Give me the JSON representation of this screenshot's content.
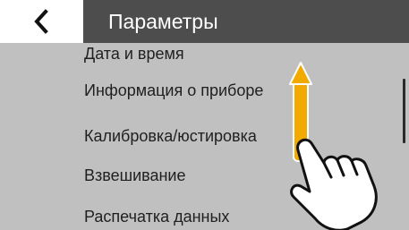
{
  "header": {
    "title": "Параметры",
    "back_icon": "chevron-left-icon"
  },
  "list": {
    "items": [
      "Дата и время",
      "Информация о приборе",
      "Калибровка/юстировка",
      "Взвешивание",
      "Распечатка данных"
    ]
  },
  "gesture": {
    "icon": "swipe-up-hand-icon",
    "arrow_color": "#f2a900"
  },
  "colors": {
    "header_bg": "#4d4d4d",
    "content_bg": "#c0c0c0",
    "back_bg": "#ffffff"
  }
}
